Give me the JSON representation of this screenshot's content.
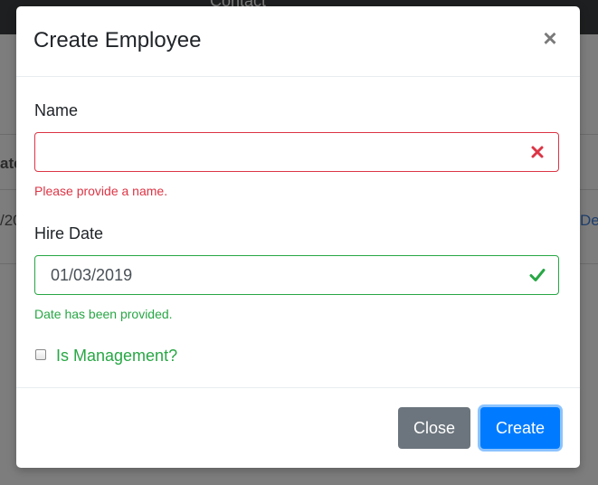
{
  "background": {
    "nav_text": "Contact",
    "column_fragment": "ate",
    "row_fragment": "/20",
    "link_fragment": "De"
  },
  "modal": {
    "title": "Create Employee",
    "close_symbol": "×",
    "name_field": {
      "label": "Name",
      "value": "",
      "error": "Please provide a name.",
      "state_icon": "x-icon",
      "state_color": "#dc3545"
    },
    "hire_date_field": {
      "label": "Hire Date",
      "value": "01/03/2019",
      "feedback": "Date has been provided.",
      "state_icon": "checkmark-icon",
      "state_color": "#28a745"
    },
    "management_checkbox": {
      "label": "Is Management?",
      "checked": false
    },
    "buttons": {
      "close_label": "Close",
      "create_label": "Create"
    }
  }
}
